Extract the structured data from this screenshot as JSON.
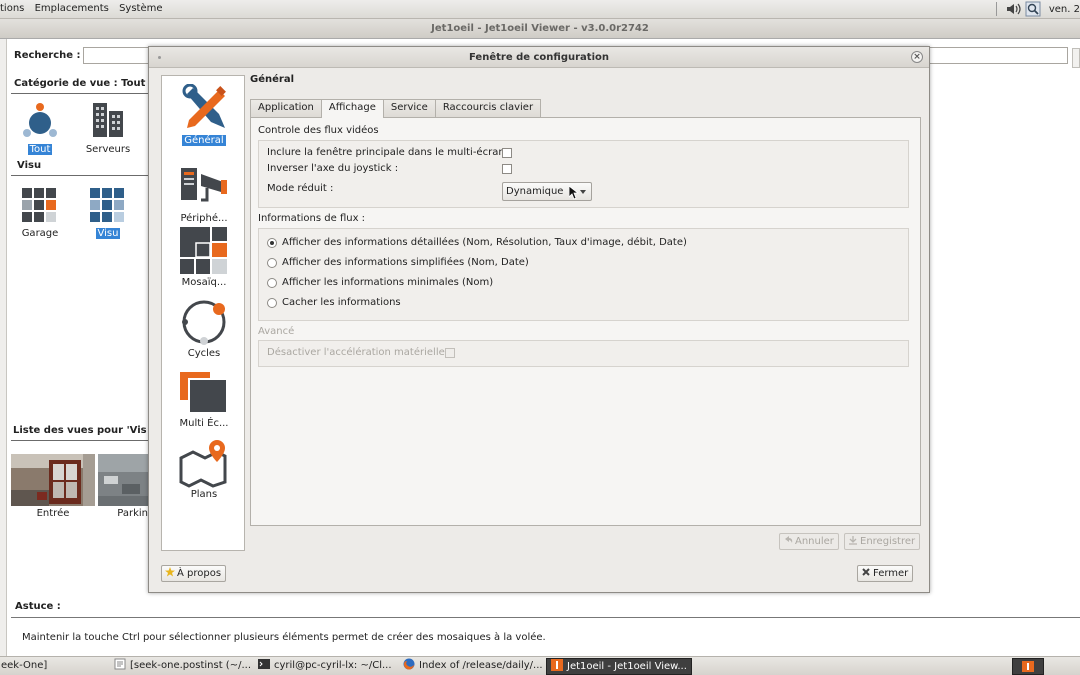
{
  "top_panel": {
    "menus": [
      "tions",
      "Emplacements",
      "Système"
    ],
    "date_text": "ven. 2"
  },
  "main_window": {
    "title": "Jet1oeil - Jet1oeil Viewer - v3.0.0r2742",
    "search_label": "Recherche :",
    "category_label": "Catégorie de vue : Tout",
    "categories": [
      {
        "label": "Tout",
        "selected": true,
        "icon": "all-icon"
      },
      {
        "label": "Serveurs",
        "selected": false,
        "icon": "servers-icon"
      }
    ],
    "visu_label": "Visu",
    "visu_items": [
      {
        "label": "Garage",
        "selected": false
      },
      {
        "label": "Visu",
        "selected": true
      }
    ],
    "views_list_label": "Liste des vues pour 'Vis",
    "views": [
      {
        "label": "Entrée"
      },
      {
        "label": "Parkin"
      }
    ],
    "tip_title": "Astuce :",
    "tip_text": "Maintenir la touche Ctrl pour sélectionner plusieurs éléments permet de créer des mosaiques à la volée."
  },
  "dialog": {
    "title": "Fenêtre de configuration",
    "sidebar": [
      {
        "label": "Général",
        "selected": true,
        "icon": "tools-icon"
      },
      {
        "label": "Périphé...",
        "selected": false,
        "icon": "peripherals-icon"
      },
      {
        "label": "Mosaïq...",
        "selected": false,
        "icon": "mosaic-icon"
      },
      {
        "label": "Cycles",
        "selected": false,
        "icon": "cycles-icon"
      },
      {
        "label": "Multi Éc...",
        "selected": false,
        "icon": "multi-screen-icon"
      },
      {
        "label": "Plans",
        "selected": false,
        "icon": "map-pin-icon"
      }
    ],
    "panel_title": "Général",
    "tabs": [
      {
        "label": "Application",
        "active": false
      },
      {
        "label": "Affichage",
        "active": true
      },
      {
        "label": "Service",
        "active": false
      },
      {
        "label": "Raccourcis clavier",
        "active": false
      }
    ],
    "video_group": {
      "title": "Controle des flux vidéos",
      "include_main_label": "Inclure la fenêtre principale dans le multi-écran :",
      "include_main_checked": false,
      "invert_joystick_label": "Inverser l'axe du joystick :",
      "invert_joystick_checked": false,
      "reduced_mode_label": "Mode réduit :",
      "reduced_mode_value": "Dynamique"
    },
    "info_group": {
      "title": "Informations de flux :",
      "options": [
        {
          "label": "Afficher des informations détaillées (Nom, Résolution, Taux d'image, débit, Date)",
          "selected": true
        },
        {
          "label": "Afficher des informations simplifiées (Nom, Date)",
          "selected": false
        },
        {
          "label": "Afficher les informations minimales (Nom)",
          "selected": false
        },
        {
          "label": "Cacher les informations",
          "selected": false
        }
      ]
    },
    "advanced_group": {
      "title": "Avancé",
      "disable_accel_label": "Désactiver l'accélération matérielle :",
      "disable_accel_checked": false
    },
    "buttons": {
      "cancel": "Annuler",
      "save": "Enregistrer",
      "about": "À propos",
      "close": "Fermer"
    }
  },
  "taskbar": {
    "tasks": [
      {
        "label": "eek-One]",
        "active": false
      },
      {
        "label": "[seek-one.postinst (~/...",
        "active": false
      },
      {
        "label": "cyril@pc-cyril-lx: ~/Cl...",
        "active": false
      },
      {
        "label": "Index of /release/daily/...",
        "active": false
      },
      {
        "label": "Jet1oeil - Jet1oeil View...",
        "active": true
      }
    ]
  },
  "colors": {
    "accent_orange": "#e8691e",
    "selection_blue": "#3584d6",
    "icon_dark": "#3f4348"
  }
}
